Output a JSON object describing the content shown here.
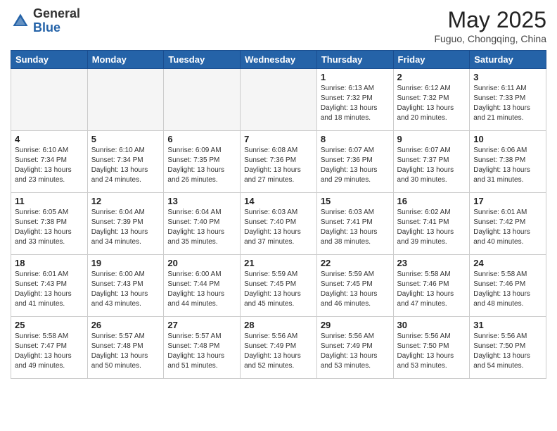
{
  "header": {
    "logo_general": "General",
    "logo_blue": "Blue",
    "month_year": "May 2025",
    "location": "Fuguo, Chongqing, China"
  },
  "weekdays": [
    "Sunday",
    "Monday",
    "Tuesday",
    "Wednesday",
    "Thursday",
    "Friday",
    "Saturday"
  ],
  "weeks": [
    [
      {
        "day": null,
        "info": ""
      },
      {
        "day": null,
        "info": ""
      },
      {
        "day": null,
        "info": ""
      },
      {
        "day": null,
        "info": ""
      },
      {
        "day": "1",
        "info": "Sunrise: 6:13 AM\nSunset: 7:32 PM\nDaylight: 13 hours\nand 18 minutes."
      },
      {
        "day": "2",
        "info": "Sunrise: 6:12 AM\nSunset: 7:32 PM\nDaylight: 13 hours\nand 20 minutes."
      },
      {
        "day": "3",
        "info": "Sunrise: 6:11 AM\nSunset: 7:33 PM\nDaylight: 13 hours\nand 21 minutes."
      }
    ],
    [
      {
        "day": "4",
        "info": "Sunrise: 6:10 AM\nSunset: 7:34 PM\nDaylight: 13 hours\nand 23 minutes."
      },
      {
        "day": "5",
        "info": "Sunrise: 6:10 AM\nSunset: 7:34 PM\nDaylight: 13 hours\nand 24 minutes."
      },
      {
        "day": "6",
        "info": "Sunrise: 6:09 AM\nSunset: 7:35 PM\nDaylight: 13 hours\nand 26 minutes."
      },
      {
        "day": "7",
        "info": "Sunrise: 6:08 AM\nSunset: 7:36 PM\nDaylight: 13 hours\nand 27 minutes."
      },
      {
        "day": "8",
        "info": "Sunrise: 6:07 AM\nSunset: 7:36 PM\nDaylight: 13 hours\nand 29 minutes."
      },
      {
        "day": "9",
        "info": "Sunrise: 6:07 AM\nSunset: 7:37 PM\nDaylight: 13 hours\nand 30 minutes."
      },
      {
        "day": "10",
        "info": "Sunrise: 6:06 AM\nSunset: 7:38 PM\nDaylight: 13 hours\nand 31 minutes."
      }
    ],
    [
      {
        "day": "11",
        "info": "Sunrise: 6:05 AM\nSunset: 7:38 PM\nDaylight: 13 hours\nand 33 minutes."
      },
      {
        "day": "12",
        "info": "Sunrise: 6:04 AM\nSunset: 7:39 PM\nDaylight: 13 hours\nand 34 minutes."
      },
      {
        "day": "13",
        "info": "Sunrise: 6:04 AM\nSunset: 7:40 PM\nDaylight: 13 hours\nand 35 minutes."
      },
      {
        "day": "14",
        "info": "Sunrise: 6:03 AM\nSunset: 7:40 PM\nDaylight: 13 hours\nand 37 minutes."
      },
      {
        "day": "15",
        "info": "Sunrise: 6:03 AM\nSunset: 7:41 PM\nDaylight: 13 hours\nand 38 minutes."
      },
      {
        "day": "16",
        "info": "Sunrise: 6:02 AM\nSunset: 7:41 PM\nDaylight: 13 hours\nand 39 minutes."
      },
      {
        "day": "17",
        "info": "Sunrise: 6:01 AM\nSunset: 7:42 PM\nDaylight: 13 hours\nand 40 minutes."
      }
    ],
    [
      {
        "day": "18",
        "info": "Sunrise: 6:01 AM\nSunset: 7:43 PM\nDaylight: 13 hours\nand 41 minutes."
      },
      {
        "day": "19",
        "info": "Sunrise: 6:00 AM\nSunset: 7:43 PM\nDaylight: 13 hours\nand 43 minutes."
      },
      {
        "day": "20",
        "info": "Sunrise: 6:00 AM\nSunset: 7:44 PM\nDaylight: 13 hours\nand 44 minutes."
      },
      {
        "day": "21",
        "info": "Sunrise: 5:59 AM\nSunset: 7:45 PM\nDaylight: 13 hours\nand 45 minutes."
      },
      {
        "day": "22",
        "info": "Sunrise: 5:59 AM\nSunset: 7:45 PM\nDaylight: 13 hours\nand 46 minutes."
      },
      {
        "day": "23",
        "info": "Sunrise: 5:58 AM\nSunset: 7:46 PM\nDaylight: 13 hours\nand 47 minutes."
      },
      {
        "day": "24",
        "info": "Sunrise: 5:58 AM\nSunset: 7:46 PM\nDaylight: 13 hours\nand 48 minutes."
      }
    ],
    [
      {
        "day": "25",
        "info": "Sunrise: 5:58 AM\nSunset: 7:47 PM\nDaylight: 13 hours\nand 49 minutes."
      },
      {
        "day": "26",
        "info": "Sunrise: 5:57 AM\nSunset: 7:48 PM\nDaylight: 13 hours\nand 50 minutes."
      },
      {
        "day": "27",
        "info": "Sunrise: 5:57 AM\nSunset: 7:48 PM\nDaylight: 13 hours\nand 51 minutes."
      },
      {
        "day": "28",
        "info": "Sunrise: 5:56 AM\nSunset: 7:49 PM\nDaylight: 13 hours\nand 52 minutes."
      },
      {
        "day": "29",
        "info": "Sunrise: 5:56 AM\nSunset: 7:49 PM\nDaylight: 13 hours\nand 53 minutes."
      },
      {
        "day": "30",
        "info": "Sunrise: 5:56 AM\nSunset: 7:50 PM\nDaylight: 13 hours\nand 53 minutes."
      },
      {
        "day": "31",
        "info": "Sunrise: 5:56 AM\nSunset: 7:50 PM\nDaylight: 13 hours\nand 54 minutes."
      }
    ]
  ]
}
